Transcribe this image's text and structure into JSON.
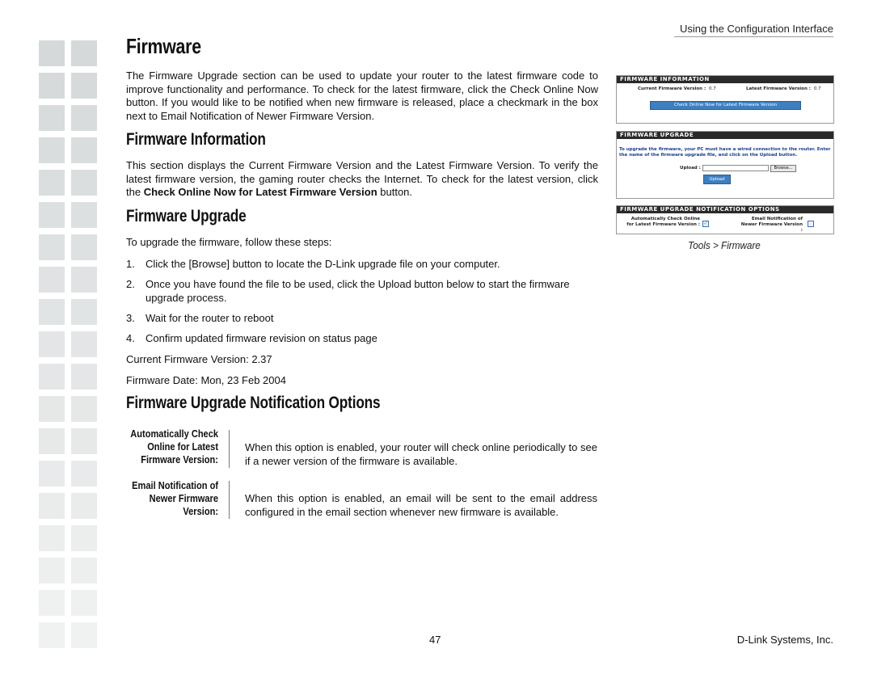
{
  "header": {
    "section": "Using the Configuration Interface"
  },
  "title": "Firmware",
  "intro": "The Firmware Upgrade section can be used to update your router to the latest firmware code to improve functionality and performance. To check for the latest firmware, click the Check Online Now button. If you would like to be notified when new firmware is released, place a checkmark in the box next to Email Notification of Newer Firmware Version.",
  "firmware_information": {
    "heading": "Firmware Information",
    "text_before": "This section displays the Current Firmware Version and the Latest Firmware Version. To verify the latest firmware version, the gaming router checks the Internet. To check for the latest version, click the ",
    "text_bold": "Check Online Now for Latest Firmware Version",
    "text_after": " button."
  },
  "firmware_upgrade": {
    "heading": "Firmware Upgrade",
    "lead": "To upgrade the firmware, follow these steps:",
    "steps": [
      {
        "num": "1.",
        "text": "Click the [Browse] button to locate the D-Link upgrade file on your computer."
      },
      {
        "num": "2.",
        "text": "Once you have found the file to be used, click the Upload button below to start the firmware upgrade process."
      },
      {
        "num": "3.",
        "text": "Wait for the router to reboot"
      },
      {
        "num": "4.",
        "text": "Confirm updated firmware revision on status page"
      }
    ],
    "current_version": "Current Firmware Version: 2.37",
    "firmware_date": "Firmware Date: Mon, 23 Feb 2004"
  },
  "notification_options": {
    "heading": "Firmware Upgrade Notification Options",
    "items": [
      {
        "label_lines": [
          "Automatically Check",
          "Online for Latest",
          "Firmware Version:"
        ],
        "description": "When this option is enabled, your router will check online periodically to see if a newer version of the firmware is available."
      },
      {
        "label_lines": [
          "Email Notification of",
          "Newer Firmware",
          "Version:"
        ],
        "description": "When this option is enabled, an email will be sent to the email address configured in the email section whenever new firmware is available."
      }
    ]
  },
  "screenshot": {
    "info_panel": {
      "title": "FIRMWARE INFORMATION",
      "current_label": "Current Firmware Version :",
      "current_value": "0.7",
      "latest_label": "Latest Firmware Version :",
      "latest_value": "0.7",
      "check_button": "Check Online Now for Latest Firmware Version"
    },
    "upgrade_panel": {
      "title": "FIRMWARE UPGRADE",
      "instructions": "To upgrade the firmware, your PC must have a wired connection to the router. Enter the name of the firmware upgrade file, and click on the Upload button.",
      "upload_label": "Upload :",
      "upload_value": "",
      "browse_button": "Browse...",
      "upload_button": "Upload"
    },
    "notify_panel": {
      "title": "FIRMWARE UPGRADE NOTIFICATION OPTIONS",
      "auto_check_label": "Automatically Check Online for Latest Firmware Version :",
      "auto_check_checked": true,
      "email_label": "Email Notification of Newer Firmware Version :",
      "email_checked": false
    },
    "caption": "Tools > Firmware"
  },
  "footer": {
    "page_number": "47",
    "company": "D-Link Systems, Inc."
  },
  "colors": {
    "panel_bar": "#2a2a2a",
    "button_blue": "#3d7fc0",
    "deco_top": "#d5d9da",
    "deco_bottom": "#f0f1f1"
  }
}
